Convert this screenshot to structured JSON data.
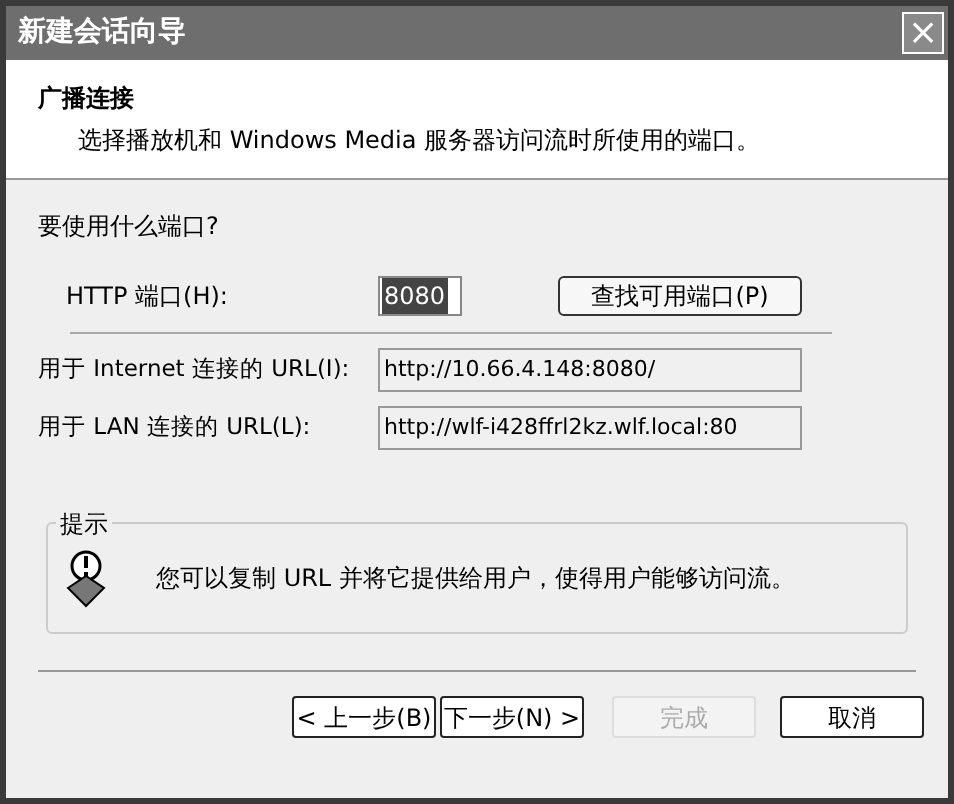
{
  "window": {
    "title": "新建会话向导",
    "close": "×"
  },
  "header": {
    "title": "广播连接",
    "subtitle": "选择播放机和 Windows Media 服务器访问流时所使用的端口。"
  },
  "question": "要使用什么端口?",
  "port": {
    "label": "HTTP 端口(H):",
    "value": "8080",
    "text_selected": true,
    "button": "查找可用端口(P)"
  },
  "urls": [
    {
      "label": "用于 Internet 连接的 URL(I):",
      "value": "http://10.66.4.148:8080/"
    },
    {
      "label": "用于 LAN 连接的 URL(L):",
      "value": "http://wlf-i428ffrl2kz.wlf.local:80"
    }
  ],
  "hint": {
    "title": "提示",
    "text": "您可以复制 URL 并将它提供给用户，使得用户能够访问流。"
  },
  "buttons": [
    {
      "label": "< 上一步(B)",
      "disabled": false
    },
    {
      "label": "下一步(N) >",
      "disabled": false
    },
    {
      "label": "完成",
      "disabled": true
    },
    {
      "label": "取消",
      "disabled": false
    }
  ]
}
